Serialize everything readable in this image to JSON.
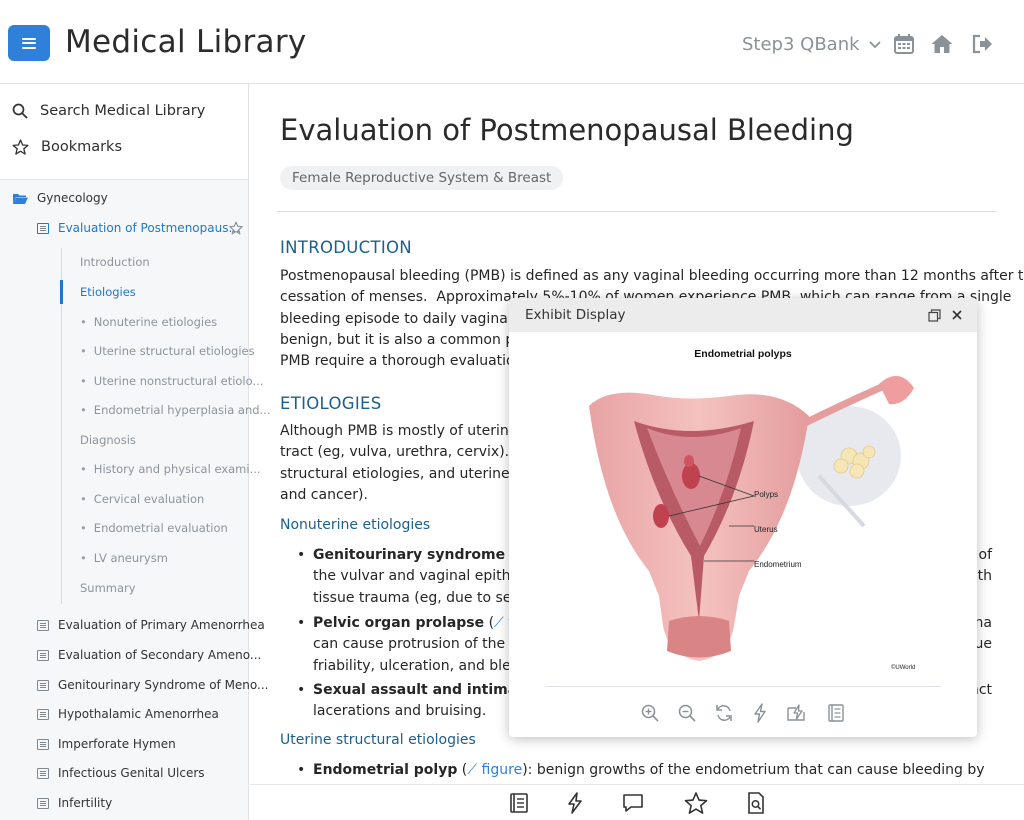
{
  "header": {
    "app_title": "Medical Library",
    "qbank_label": "Step3 QBank",
    "icons": [
      "menu-icon",
      "chevron-down-icon",
      "calendar-icon",
      "home-icon",
      "logout-icon"
    ]
  },
  "sidebar": {
    "search_label": "Search Medical Library",
    "bookmarks_label": "Bookmarks",
    "folder_label": "Gynecology",
    "current_article": "Evaluation of Postmenopaus...",
    "toc": [
      {
        "label": "Introduction"
      },
      {
        "label": "Etiologies"
      },
      {
        "label": "Nonuterine etiologies"
      },
      {
        "label": "Uterine structural etiologies"
      },
      {
        "label": "Uterine nonstructural etiolo..."
      },
      {
        "label": "Endometrial hyperplasia and..."
      },
      {
        "label": "Diagnosis"
      },
      {
        "label": "History and physical exami..."
      },
      {
        "label": "Cervical evaluation"
      },
      {
        "label": "Endometrial evaluation"
      },
      {
        "label": "LV aneurysm"
      },
      {
        "label": "Summary"
      }
    ],
    "articles": [
      {
        "label": "Evaluation of Primary Amenorrhea"
      },
      {
        "label": "Evaluation of Secondary Ameno..."
      },
      {
        "label": "Genitourinary Syndrome of Meno..."
      },
      {
        "label": "Hypothalamic Amenorrhea"
      },
      {
        "label": "Imperforate Hymen"
      },
      {
        "label": "Infectious Genital Ulcers"
      },
      {
        "label": "Infertility"
      }
    ]
  },
  "article": {
    "title": "Evaluation of Postmenopausal Bleeding",
    "category": "Female Reproductive System & Breast",
    "intro_heading": "INTRODUCTION",
    "intro_lines": [
      "Postmenopausal bleeding (PMB) is defined as any vaginal bleeding occurring more than 12 months after the",
      "cessation of menses.  Approximately 5%-10% of women experience PMB, which can range from a single",
      "bleeding episode to daily vaginal bleeding.                                                                   are",
      "benign, but it is also a common presenting                                                                  with",
      "PMB require a thorough evaluation."
    ],
    "etiologies_heading": "ETIOLOGIES",
    "etiologies_lines": [
      "Although PMB is mostly of uterine origin                                                                     tal",
      "tract (eg, vulva, urethra, cervix).  The                                                                    ne",
      "structural etiologies, and uterine non                                                                      sia",
      "and cancer)."
    ],
    "nonuterine_heading": "Nonuterine etiologies",
    "bullet1_bold": "Genitourinary syndrome of",
    "bullet1_right": "of",
    "bullet1_lines": [
      "the vulvar and vaginal epithe",
      "tissue trauma (eg, due to sexu"
    ],
    "bullet1_line2_right": "ith",
    "bullet2_bold": "Pelvic organ prolapse",
    "bullet2_link": "figure",
    "bullet2_right": "na",
    "bullet2_lines": [
      "can cause protrusion of the v",
      "friability, ulceration, and blee"
    ],
    "bullet2_line2_right": "ue",
    "bullet3_bold": "Sexual assault and intimate",
    "bullet3_right": "act",
    "bullet3_line2": "lacerations and bruising.",
    "uterine_heading": "Uterine structural etiologies",
    "bullet4_bold": "Endometrial polyp",
    "bullet4_link": "figure",
    "bullet4_rest": "):  benign growths of the endometrium that can cause bleeding by disrupting"
  },
  "exhibit": {
    "title": "Exhibit Display",
    "image_title": "Endometrial polyps",
    "labels": [
      "Polyps",
      "Uterus",
      "Endometrium"
    ],
    "credit": "©UWorld",
    "tools": [
      "zoom-in-icon",
      "zoom-out-icon",
      "reset-icon",
      "flash-icon",
      "flash-add-icon",
      "notebook-icon"
    ]
  },
  "bottom_toolbar": {
    "icons": [
      "notebook-icon",
      "flashcard-icon",
      "comment-icon",
      "star-icon",
      "search-doc-icon"
    ]
  },
  "colors": {
    "accent": "#2f80d8",
    "heading": "#1d5e8c",
    "sidebar_bg": "#f5f7f9"
  }
}
